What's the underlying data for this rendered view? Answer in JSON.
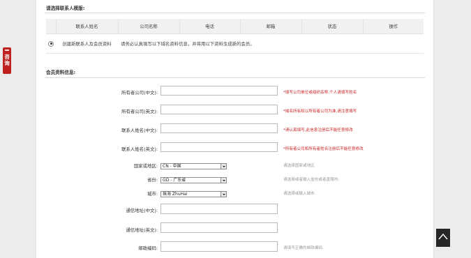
{
  "side_tab": {
    "label": "咨询"
  },
  "contact_section": {
    "title": "请选择联系人模版:",
    "columns": [
      "联系人姓名",
      "公司名称",
      "电话",
      "邮箱",
      "状态",
      "操作"
    ],
    "row": {
      "name": "创建新联系人及会员资料",
      "message": "请务必认真填写以下域名资料信息，并将用以下资料生成新的会员。"
    }
  },
  "member_section": {
    "title": "会员资料信息:",
    "fields": [
      {
        "label": "所有者公司(中文):",
        "value": "",
        "hint": "*填写公司单位或组织名称,个人请填写姓名"
      },
      {
        "label": "所有者公司(英文):",
        "value": "",
        "hint": "*域名所有权以所有者公司为准,请注意填写"
      },
      {
        "label": "联系人姓名(中文):",
        "value": "",
        "hint": "*请认真填写,此信息注册后不能任意修改"
      },
      {
        "label": "联系人姓名(英文):",
        "value": "",
        "hint": "*所有者公司和所有者姓名注册后不能任意修改"
      }
    ],
    "selects": [
      {
        "label": "国家或地区:",
        "value": "CN - 中国",
        "hint": "请选择国家或地区."
      },
      {
        "label": "省份:",
        "value": "GD - 广东省",
        "hint": "请选择或者输入省份或者直辖市."
      },
      {
        "label": "城市:",
        "value": "珠海  ZhuHai",
        "hint": "请选择或输入城市."
      }
    ],
    "address_cn": {
      "label": "通信地址(中文):",
      "value": ""
    },
    "address_en": {
      "label": "通信地址(英文):",
      "value": ""
    },
    "postcode": {
      "label": "邮政编码:",
      "value": "",
      "hint": "请填写正确的邮政编码."
    }
  },
  "colors": {
    "accent": "#bf2121",
    "hint_red": "#cc1f1f",
    "hint_gray": "#999999"
  },
  "icons": {
    "side_tab": "chat-icon",
    "back_to_top": "arrow-up-icon"
  }
}
